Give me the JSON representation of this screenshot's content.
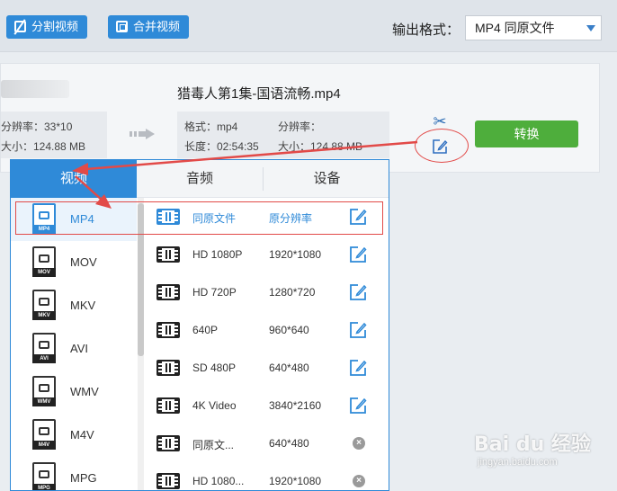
{
  "toolbar": {
    "split_label": "分割视频",
    "merge_label": "合并视频",
    "output_format_label": "输出格式：",
    "output_format_value": "MP4  同原文件"
  },
  "file": {
    "title": "猎毒人第1集-国语流畅.mp4",
    "source_resolution": "分辨率：33*10",
    "source_size": "大小：124.88 MB",
    "target_format": "格式：mp4",
    "target_resolution": "分辨率：",
    "target_duration": "长度：02:54:35",
    "target_size": "大小：124.88 MB",
    "convert_label": "转换"
  },
  "tabs": [
    {
      "label": "视频",
      "active": true
    },
    {
      "label": "音频",
      "active": false
    },
    {
      "label": "设备",
      "active": false
    }
  ],
  "formats": [
    {
      "name": "MP4",
      "tag": "MP4",
      "active": true
    },
    {
      "name": "MOV",
      "tag": "MOV",
      "active": false
    },
    {
      "name": "MKV",
      "tag": "MKV",
      "active": false
    },
    {
      "name": "AVI",
      "tag": "AVI",
      "active": false
    },
    {
      "name": "WMV",
      "tag": "WMV",
      "active": false
    },
    {
      "name": "M4V",
      "tag": "M4V",
      "active": false
    },
    {
      "name": "MPG",
      "tag": "MPG",
      "active": false
    }
  ],
  "presets": [
    {
      "name": "同原文件",
      "resolution": "原分辨率",
      "action": "edit",
      "active": true
    },
    {
      "name": "HD 1080P",
      "resolution": "1920*1080",
      "action": "edit",
      "active": false
    },
    {
      "name": "HD 720P",
      "resolution": "1280*720",
      "action": "edit",
      "active": false
    },
    {
      "name": "640P",
      "resolution": "960*640",
      "action": "edit",
      "active": false
    },
    {
      "name": "SD 480P",
      "resolution": "640*480",
      "action": "edit",
      "active": false
    },
    {
      "name": "4K Video",
      "resolution": "3840*2160",
      "action": "edit",
      "active": false
    },
    {
      "name": "同原文...",
      "resolution": "640*480",
      "action": "delete",
      "active": false
    },
    {
      "name": "HD 1080...",
      "resolution": "1920*1080",
      "action": "delete",
      "active": false
    }
  ],
  "watermark": {
    "brand": "Bai du 经验",
    "url": "jingyan.baidu.com"
  },
  "colors": {
    "accent": "#2f8ad8",
    "convert": "#4eae3c",
    "annotation": "#e24a48"
  }
}
